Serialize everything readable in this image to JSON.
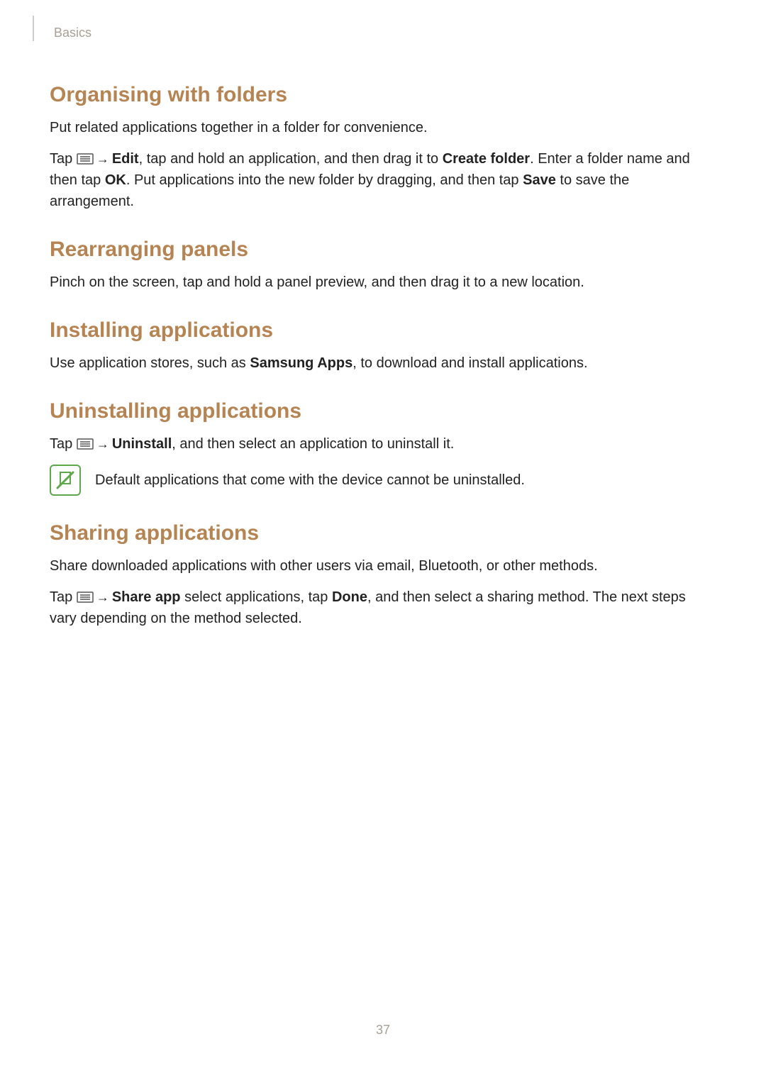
{
  "breadcrumb": "Basics",
  "page_number": "37",
  "sections": {
    "organising": {
      "heading": "Organising with folders",
      "p1": "Put related applications together in a folder for convenience.",
      "p2_pre": "Tap ",
      "p2_edit": "Edit",
      "p2_mid1": ", tap and hold an application, and then drag it to ",
      "p2_create": "Create folder",
      "p2_mid2": ". Enter a folder name and then tap ",
      "p2_ok": "OK",
      "p2_mid3": ". Put applications into the new folder by dragging, and then tap ",
      "p2_save": "Save",
      "p2_end": " to save the arrangement."
    },
    "rearranging": {
      "heading": "Rearranging panels",
      "p1": "Pinch on the screen, tap and hold a panel preview, and then drag it to a new location."
    },
    "installing": {
      "heading": "Installing applications",
      "p1_pre": "Use application stores, such as ",
      "p1_b": "Samsung Apps",
      "p1_end": ", to download and install applications."
    },
    "uninstalling": {
      "heading": "Uninstalling applications",
      "p1_pre": "Tap ",
      "p1_b": "Uninstall",
      "p1_end": ", and then select an application to uninstall it.",
      "note": "Default applications that come with the device cannot be uninstalled."
    },
    "sharing": {
      "heading": "Sharing applications",
      "p1": "Share downloaded applications with other users via email, Bluetooth, or other methods.",
      "p2_pre": "Tap ",
      "p2_share": "Share app",
      "p2_mid1": " select applications, tap ",
      "p2_done": "Done",
      "p2_end": ", and then select a sharing method. The next steps vary depending on the method selected."
    }
  },
  "arrow_glyph": "→"
}
